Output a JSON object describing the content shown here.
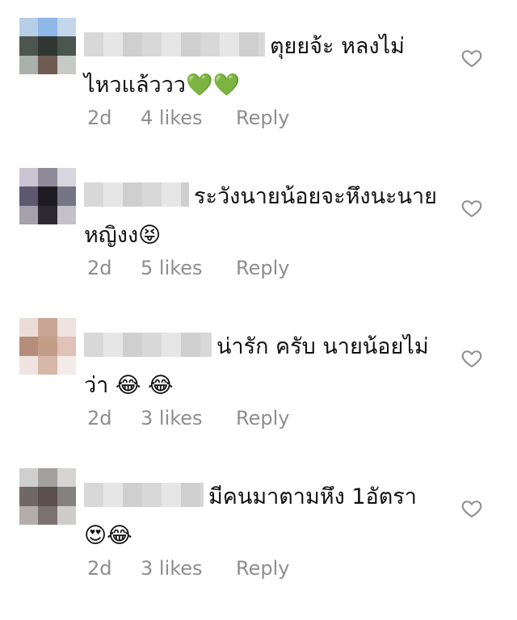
{
  "comments": [
    {
      "text": "ตุยยจ้ะ หลงไม่ไหวแล้ววว",
      "emojis": "💚💚",
      "time": "2d",
      "likes": "4 likes",
      "reply": "Reply",
      "avatar_colors": [
        "#b7cfe6",
        "#8fb7e8",
        "#c4d7ea",
        "#4d5551",
        "#303634",
        "#4a5650",
        "#aab0ac",
        "#6e5c52",
        "#c7cbc8"
      ]
    },
    {
      "text": "ระวังนายน้อยจะหึงนะนายหญิงง",
      "emojis": "😝",
      "time": "2d",
      "likes": "5 likes",
      "reply": "Reply",
      "avatar_colors": [
        "#c9c5d3",
        "#8e8a9a",
        "#d8d6de",
        "#5b5870",
        "#1e1c22",
        "#757585",
        "#a4a1ab",
        "#2c2a30",
        "#c4c2c8"
      ]
    },
    {
      "text": "น่ารัก ครับ นายน้อยไม่ ว่า",
      "emojis": "😂 😂",
      "time": "2d",
      "likes": "3 likes",
      "reply": "Reply",
      "avatar_colors": [
        "#ecdcd8",
        "#c9a595",
        "#efe2df",
        "#b68d7a",
        "#c49d88",
        "#e0c2b6",
        "#efe4e1",
        "#d7b7a8",
        "#f3ebe8"
      ]
    },
    {
      "text": "มีคนมาตามหึง 1อัตรา",
      "emojis": "😍😂",
      "time": "2d",
      "likes": "3 likes",
      "reply": "Reply",
      "avatar_colors": [
        "#d0cfcf",
        "#a3a1a0",
        "#d6d5d4",
        "#6f6867",
        "#5a4f4d",
        "#858181",
        "#b3aeac",
        "#7b7270",
        "#cfcdcc"
      ]
    }
  ],
  "ui": {
    "heart_icon": "heart-outline-icon",
    "heart_color": "#8e8e8e",
    "meta_color": "#8e8e8e"
  }
}
